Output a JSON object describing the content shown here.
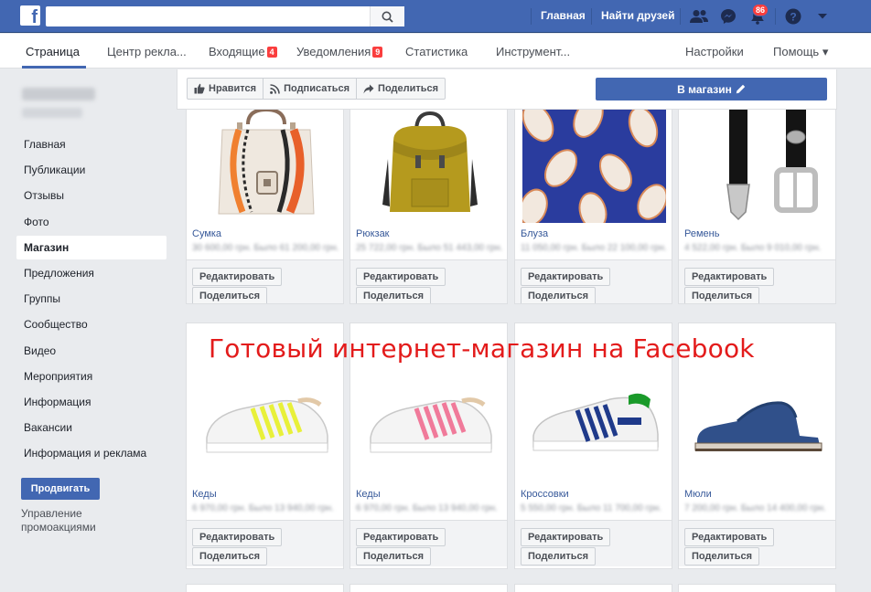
{
  "topbar": {
    "logo": "f",
    "search_placeholder": "",
    "home": "Главная",
    "find_friends": "Найти друзей",
    "notifications_count": "86"
  },
  "tabs": [
    {
      "label": "Страница",
      "badge": ""
    },
    {
      "label": "Центр рекла...",
      "badge": ""
    },
    {
      "label": "Входящие",
      "badge": "4"
    },
    {
      "label": "Уведомления",
      "badge": "9"
    },
    {
      "label": "Статистика",
      "badge": ""
    },
    {
      "label": "Инструмент...",
      "badge": ""
    },
    {
      "label": "Настройки",
      "badge": ""
    },
    {
      "label": "Помощь ▾",
      "badge": ""
    }
  ],
  "page": {
    "name": "OdriBrick",
    "handle": "@odribrick"
  },
  "sidebar": {
    "items": [
      "Главная",
      "Публикации",
      "Отзывы",
      "Фото",
      "Магазин",
      "Предложения",
      "Группы",
      "Сообщество",
      "Видео",
      "Мероприятия",
      "Информация",
      "Вакансии",
      "Информация и реклама"
    ],
    "active_index": 4,
    "promote": "Продвигать",
    "promo_management": "Управление промоакциями"
  },
  "actionbar": {
    "like": "Нравится",
    "follow": "Подписаться",
    "share": "Поделиться",
    "more": "···",
    "shop": "В магазин"
  },
  "products": [
    {
      "name": "Сумка",
      "price": "30 600,00 грн. Было 61 200,00 грн."
    },
    {
      "name": "Рюкзак",
      "price": "25 722,00 грн. Было 51 443,00 грн."
    },
    {
      "name": "Блуза",
      "price": "11 050,00 грн. Было 22 100,00 грн."
    },
    {
      "name": "Ремень",
      "price": "4 522,00 грн. Было 9 010,00 грн."
    },
    {
      "name": "Кеды",
      "price": "6 970,00 грн. Было 13 940,00 грн."
    },
    {
      "name": "Кеды",
      "price": "6 970,00 грн. Было 13 940,00 грн."
    },
    {
      "name": "Кроссовки",
      "price": "5 550,00 грн. Было 11 700,00 грн."
    },
    {
      "name": "Мюли",
      "price": "7 200,00 грн. Было 14 400,00 грн."
    }
  ],
  "card_actions": {
    "edit": "Редактировать",
    "share": "Поделиться"
  },
  "overlay_caption": "Готовый интернет-магазин на Facebook",
  "colors": {
    "brand": "#4267b2",
    "badge": "#fa3e3e",
    "caption": "#e31b1b"
  }
}
